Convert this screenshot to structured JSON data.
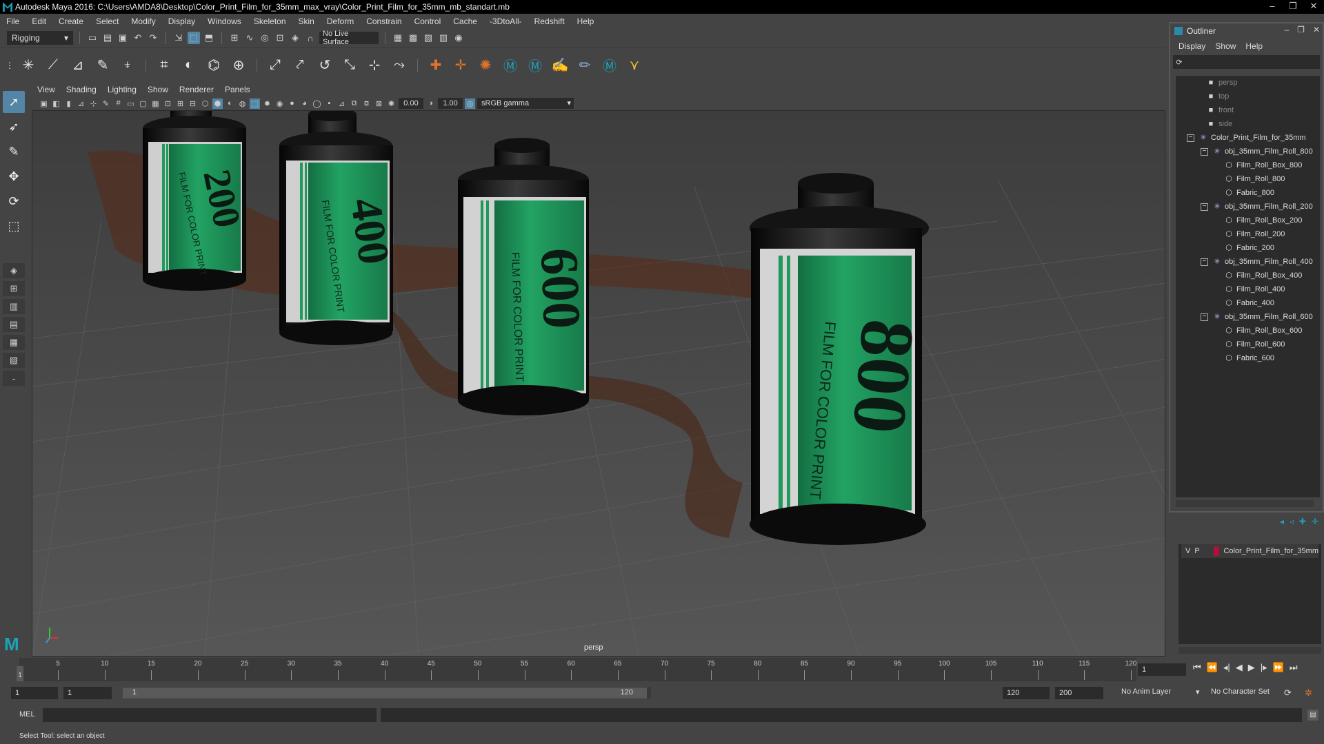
{
  "window": {
    "title": "Autodesk Maya 2016: C:\\Users\\AMDA8\\Desktop\\Color_Print_Film_for_35mm_max_vray\\Color_Print_Film_for_35mm_mb_standart.mb"
  },
  "menubar": [
    "File",
    "Edit",
    "Create",
    "Select",
    "Modify",
    "Display",
    "Windows",
    "Skeleton",
    "Skin",
    "Deform",
    "Constrain",
    "Control",
    "Cache",
    "-3DtoAll-",
    "Redshift",
    "Help"
  ],
  "statusline": {
    "menuset": "Rigging",
    "live_surface": "No Live Surface"
  },
  "viewport": {
    "menu": [
      "View",
      "Shading",
      "Lighting",
      "Show",
      "Renderer",
      "Panels"
    ],
    "exposure": "0.00",
    "gamma": "1.00",
    "color_space": "sRGB gamma",
    "camera_label": "persp",
    "film_labels": {
      "r200": "200",
      "r400": "400",
      "r600": "600",
      "r800": "800",
      "print_text": "FILM FOR COLOR PRINT"
    }
  },
  "outliner": {
    "title": "Outliner",
    "menu": [
      "Display",
      "Show",
      "Help"
    ],
    "items": [
      {
        "label": "persp",
        "dim": true
      },
      {
        "label": "top",
        "dim": true
      },
      {
        "label": "front",
        "dim": true
      },
      {
        "label": "side",
        "dim": true
      },
      {
        "label": "Color_Print_Film_for_35mm",
        "dim": false
      },
      {
        "label": "obj_35mm_Film_Roll_800",
        "dim": false
      },
      {
        "label": "Film_Roll_Box_800",
        "dim": false
      },
      {
        "label": "Film_Roll_800",
        "dim": false
      },
      {
        "label": "Fabric_800",
        "dim": false
      },
      {
        "label": "obj_35mm_Film_Roll_200",
        "dim": false
      },
      {
        "label": "Film_Roll_Box_200",
        "dim": false
      },
      {
        "label": "Film_Roll_200",
        "dim": false
      },
      {
        "label": "Fabric_200",
        "dim": false
      },
      {
        "label": "obj_35mm_Film_Roll_400",
        "dim": false
      },
      {
        "label": "Film_Roll_Box_400",
        "dim": false
      },
      {
        "label": "Film_Roll_400",
        "dim": false
      },
      {
        "label": "Fabric_400",
        "dim": false
      },
      {
        "label": "obj_35mm_Film_Roll_600",
        "dim": false
      },
      {
        "label": "Film_Roll_Box_600",
        "dim": false
      },
      {
        "label": "Film_Roll_600",
        "dim": false
      },
      {
        "label": "Fabric_600",
        "dim": false
      }
    ]
  },
  "layers": {
    "v": "V",
    "p": "P",
    "layer_name": "Color_Print_Film_for_35mm",
    "layer_color": "#b0103a"
  },
  "timeslider": {
    "ticks": [
      "5",
      "10",
      "15",
      "20",
      "25",
      "30",
      "35",
      "40",
      "45",
      "50",
      "55",
      "60",
      "65",
      "70",
      "75",
      "80",
      "85",
      "90",
      "95",
      "100",
      "105",
      "110",
      "115",
      "120"
    ],
    "current_frame": "1",
    "current_frame_field": "1"
  },
  "range": {
    "start": "1",
    "playback_start": "1",
    "thumb_start": "1",
    "thumb_end": "120",
    "playback_end": "120",
    "end": "200",
    "anim_layer": "No Anim Layer",
    "char_set": "No Character Set"
  },
  "cmdline": {
    "label": "MEL"
  },
  "helpline": {
    "text": "Select Tool: select an object"
  },
  "colors": {
    "accent": "#5285a6",
    "maya_teal": "#1ba4bd",
    "film_green": "#1e9a5c"
  }
}
